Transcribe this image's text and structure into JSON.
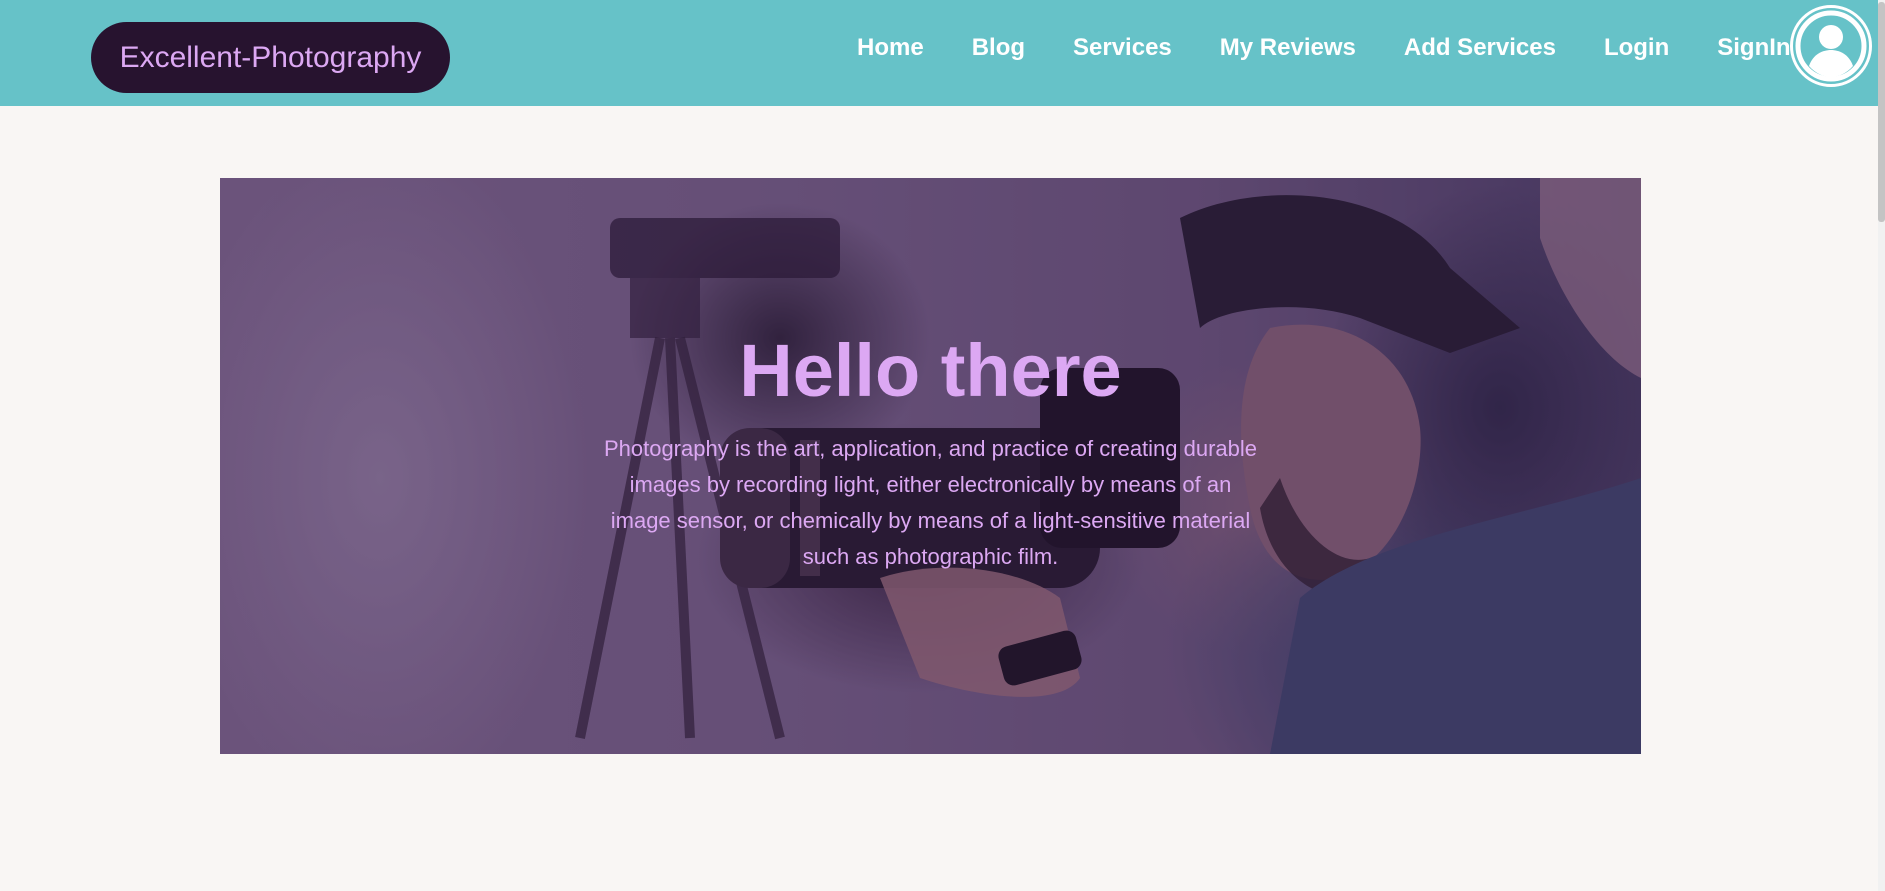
{
  "navbar": {
    "brand": "Excellent-Photography",
    "links": [
      {
        "label": "Home"
      },
      {
        "label": "Blog"
      },
      {
        "label": "Services"
      },
      {
        "label": "My Reviews"
      },
      {
        "label": "Add Services"
      },
      {
        "label": "Login"
      },
      {
        "label": "SignIn"
      }
    ],
    "avatar_icon": "user-circle-icon"
  },
  "hero": {
    "title": "Hello there",
    "text": "Photography is the art, application, and practice of creating durable images by recording light, either electronically by means of an image sensor, or chemically by means of a light-sensitive material such as photographic film.",
    "background_image": "photographer-with-camera"
  },
  "colors": {
    "navbar": "#66c2c8",
    "brand_bg": "#27132f",
    "accent_text": "#dca8f3",
    "page_bg": "#f9f6f4"
  }
}
